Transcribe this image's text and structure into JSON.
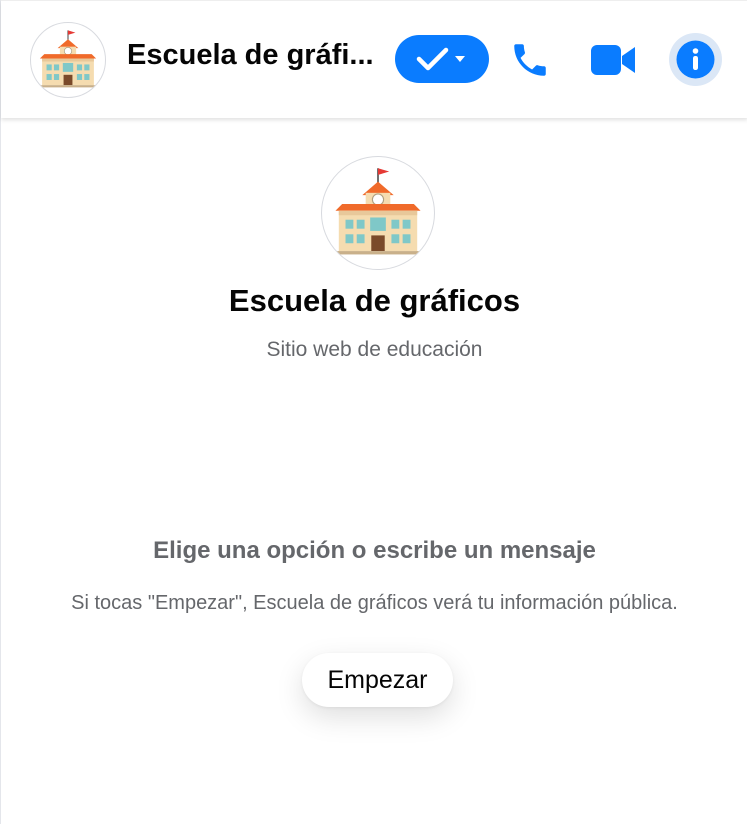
{
  "header": {
    "title": "Escuela de gráfi...",
    "avatar_icon": "school-building-icon",
    "status_icon": "check-icon",
    "dropdown_icon": "caret-down-icon",
    "call_icon": "phone-icon",
    "video_icon": "video-camera-icon",
    "info_icon": "info-icon"
  },
  "profile": {
    "name": "Escuela de gráficos",
    "category": "Sitio web de educación",
    "avatar_icon": "school-building-icon"
  },
  "welcome": {
    "prompt": "Elige una opción o escribe un mensaje",
    "notice": "Si tocas \"Empezar\", Escuela de gráficos verá tu información pública.",
    "start_label": "Empezar"
  },
  "colors": {
    "accent": "#0a7cff",
    "info_bg": "#dbe7f6",
    "muted_text": "#65676b"
  }
}
